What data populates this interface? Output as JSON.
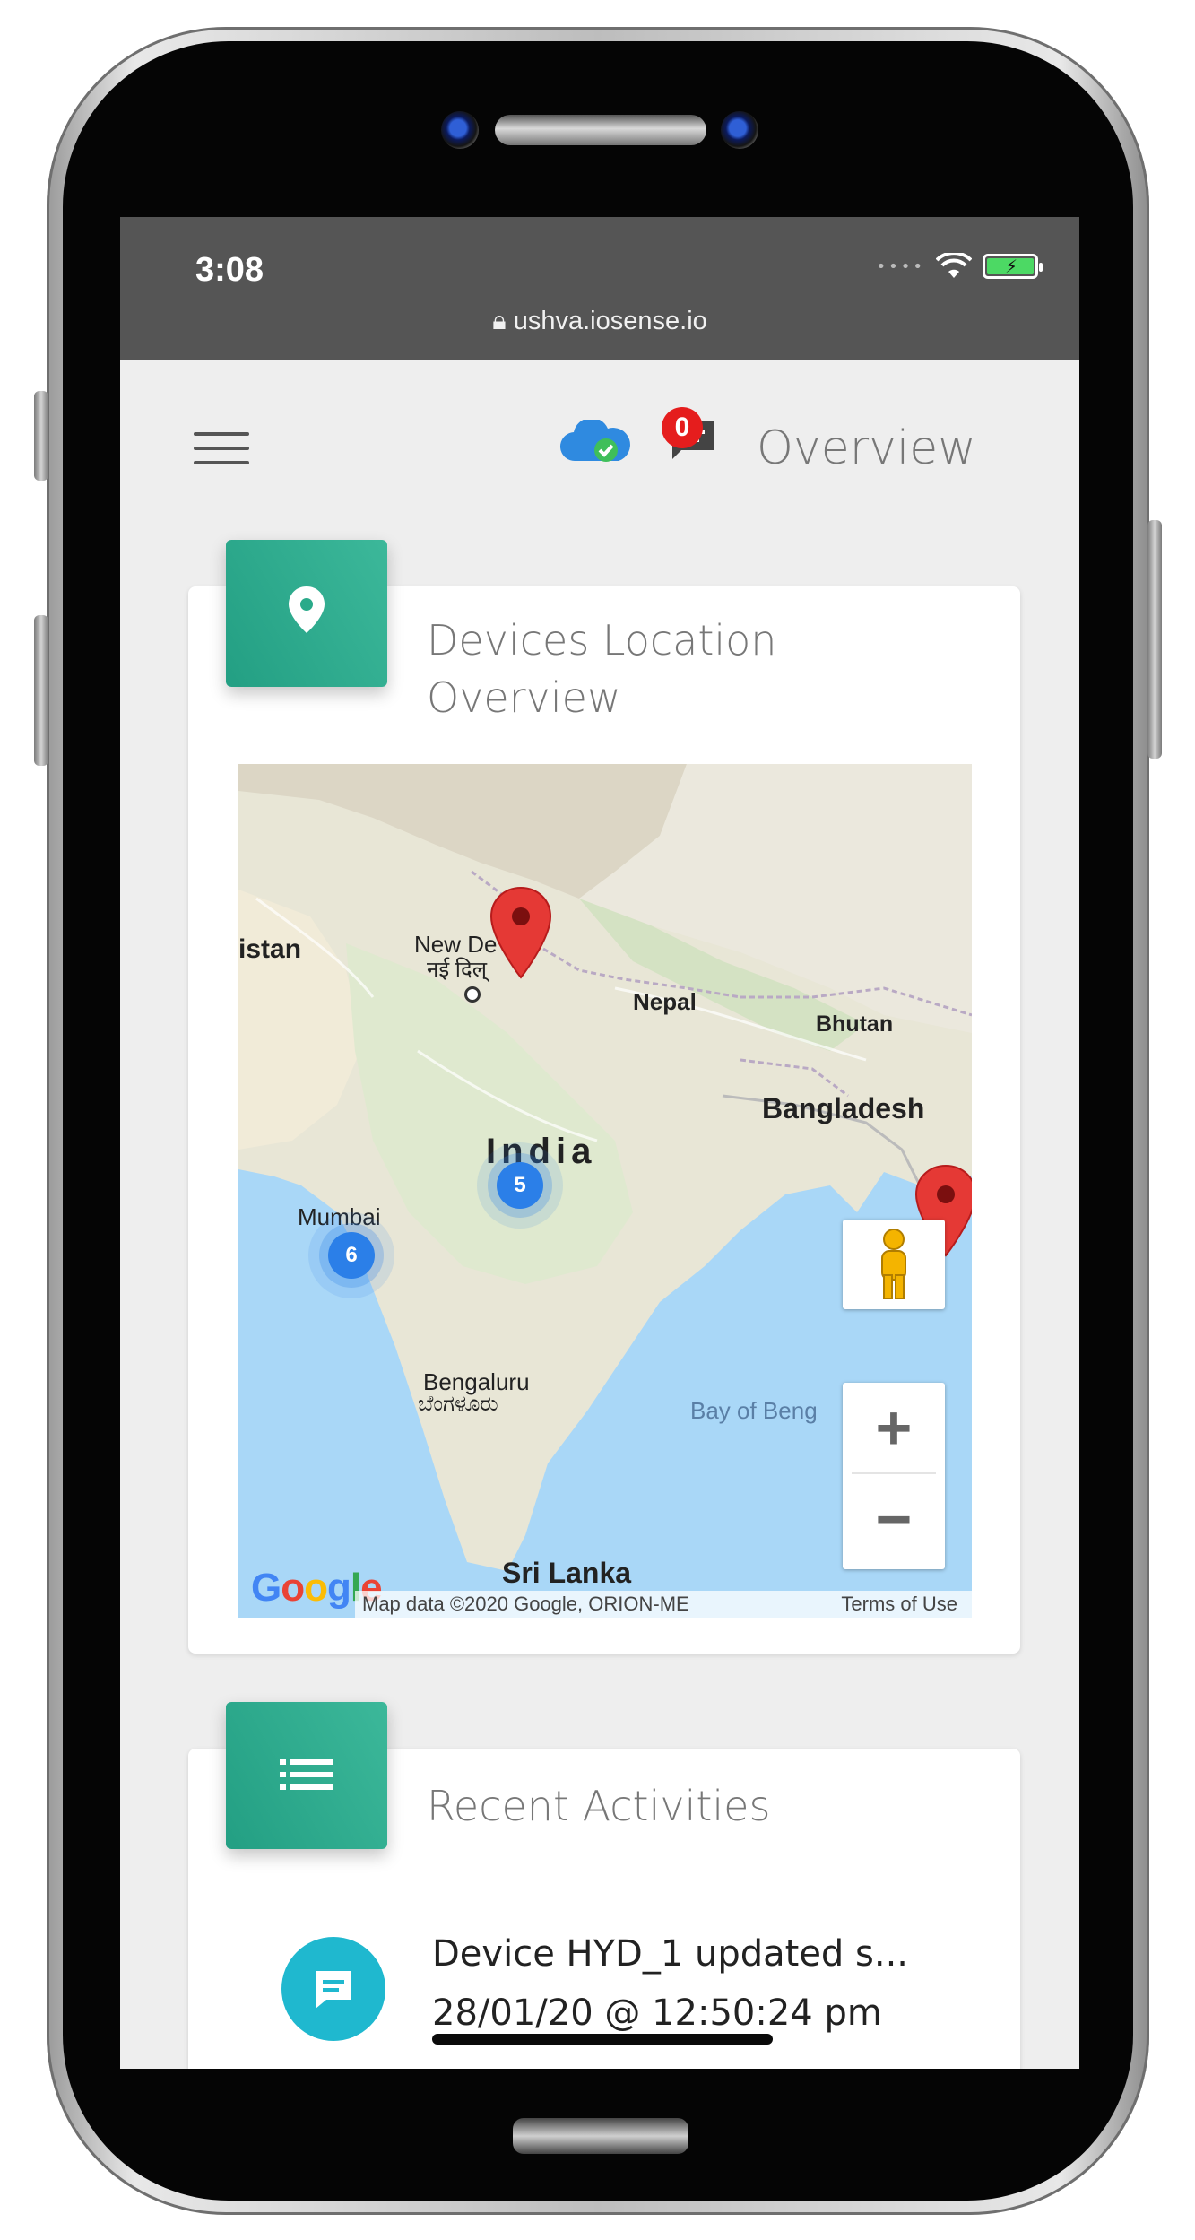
{
  "status_bar": {
    "time": "3:08",
    "url": "ushva.iosense.io"
  },
  "app_bar": {
    "title": "Overview",
    "notification_count": "0"
  },
  "location_card": {
    "title_line1": "Devices Location",
    "title_line2": "Overview",
    "map": {
      "labels": {
        "pakistan_partial": "istan",
        "new_delhi": "New De",
        "new_delhi_hindi": "नई दिल्",
        "nepal": "Nepal",
        "bhutan": "Bhutan",
        "bangladesh": "Bangladesh",
        "india": "India",
        "mumbai": "Mumbai",
        "bengaluru": "Bengaluru",
        "bengaluru_kannada": "ಬೆಂಗಳೂರು",
        "bay_of_bengal": "Bay of Beng",
        "sri_lanka": "Sri Lanka"
      },
      "clusters": [
        {
          "count": "5"
        },
        {
          "count": "6"
        }
      ],
      "zoom_in": "+",
      "zoom_out": "−",
      "google_logo": "Google",
      "attribution": "Map data ©2020 Google, ORION-ME",
      "terms": "Terms of Use"
    }
  },
  "activities_card": {
    "title": "Recent Activities",
    "items": [
      {
        "text": "Device HYD_1 updated s...",
        "timestamp": "28/01/20 @ 12:50:24 pm"
      }
    ]
  },
  "colors": {
    "status_bar": "#555555",
    "card_icon_green": "#2aaa8a",
    "badge_red": "#e51d1d",
    "activity_cyan": "#1fb8cf",
    "cluster_blue": "#2b7fe8",
    "pin_red": "#e53935"
  }
}
